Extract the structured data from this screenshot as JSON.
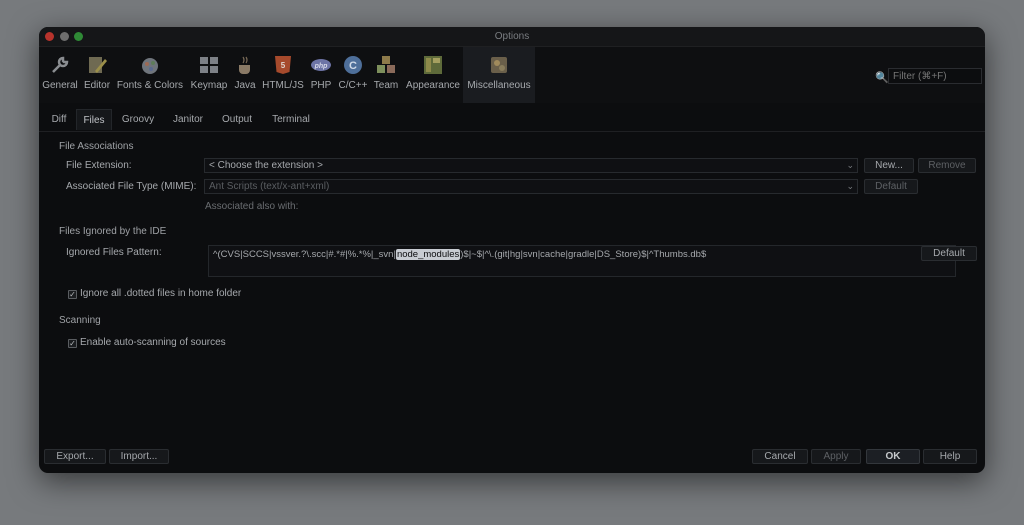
{
  "window": {
    "title": "Options"
  },
  "toolbar": {
    "items": [
      {
        "label": "General",
        "icon": "wrench-icon",
        "color": "#8a8d91"
      },
      {
        "label": "Editor",
        "icon": "editor-icon",
        "color": "#9b8f4a"
      },
      {
        "label": "Fonts & Colors",
        "icon": "fonts-colors-icon",
        "color": "#8a9099"
      },
      {
        "label": "Keymap",
        "icon": "keymap-icon",
        "color": "#7d8187"
      },
      {
        "label": "Java",
        "icon": "java-cup-icon",
        "color": "#8a7a66"
      },
      {
        "label": "HTML/JS",
        "icon": "html5-icon",
        "color": "#a64a2c"
      },
      {
        "label": "PHP",
        "icon": "php-icon",
        "color": "#6d74a6"
      },
      {
        "label": "C/C++",
        "icon": "cpp-icon",
        "color": "#4e6f9a"
      },
      {
        "label": "Team",
        "icon": "team-icon",
        "color": "#7d8f5c"
      },
      {
        "label": "Appearance",
        "icon": "appearance-icon",
        "color": "#8d8a4a"
      },
      {
        "label": "Miscellaneous",
        "icon": "miscellaneous-icon",
        "color": "#8a7d5c"
      }
    ],
    "filter_placeholder": "Filter (⌘+F)"
  },
  "tabs": [
    "Diff",
    "Files",
    "Groovy",
    "Janitor",
    "Output",
    "Terminal"
  ],
  "active_tab": "Files",
  "file_associations": {
    "heading": "File Associations",
    "file_extension_label": "File Extension:",
    "file_extension_value": "< Choose the extension >",
    "new_button": "New...",
    "remove_button": "Remove",
    "mime_label": "Associated File Type (MIME):",
    "mime_value": "Ant Scripts (text/x-ant+xml)",
    "mime_default_button": "Default",
    "also_with": "Associated also with:"
  },
  "ignored": {
    "heading": "Files Ignored by the IDE",
    "pattern_label": "Ignored Files Pattern:",
    "pattern_before": "^(CVS|SCCS|vssver.?\\.scc|#.*#|%.*%|_svn|",
    "pattern_highlight": "node_modules",
    "pattern_after": ")$|~$|^\\.(git|hg|svn|cache|gradle|DS_Store)$|^Thumbs.db$",
    "default_button": "Default",
    "dotted_checkbox": "Ignore all .dotted files in home folder"
  },
  "scanning": {
    "heading": "Scanning",
    "auto_scan_checkbox": "Enable auto-scanning of sources"
  },
  "footer": {
    "export": "Export...",
    "import": "Import...",
    "cancel": "Cancel",
    "apply": "Apply",
    "ok": "OK",
    "help": "Help"
  }
}
